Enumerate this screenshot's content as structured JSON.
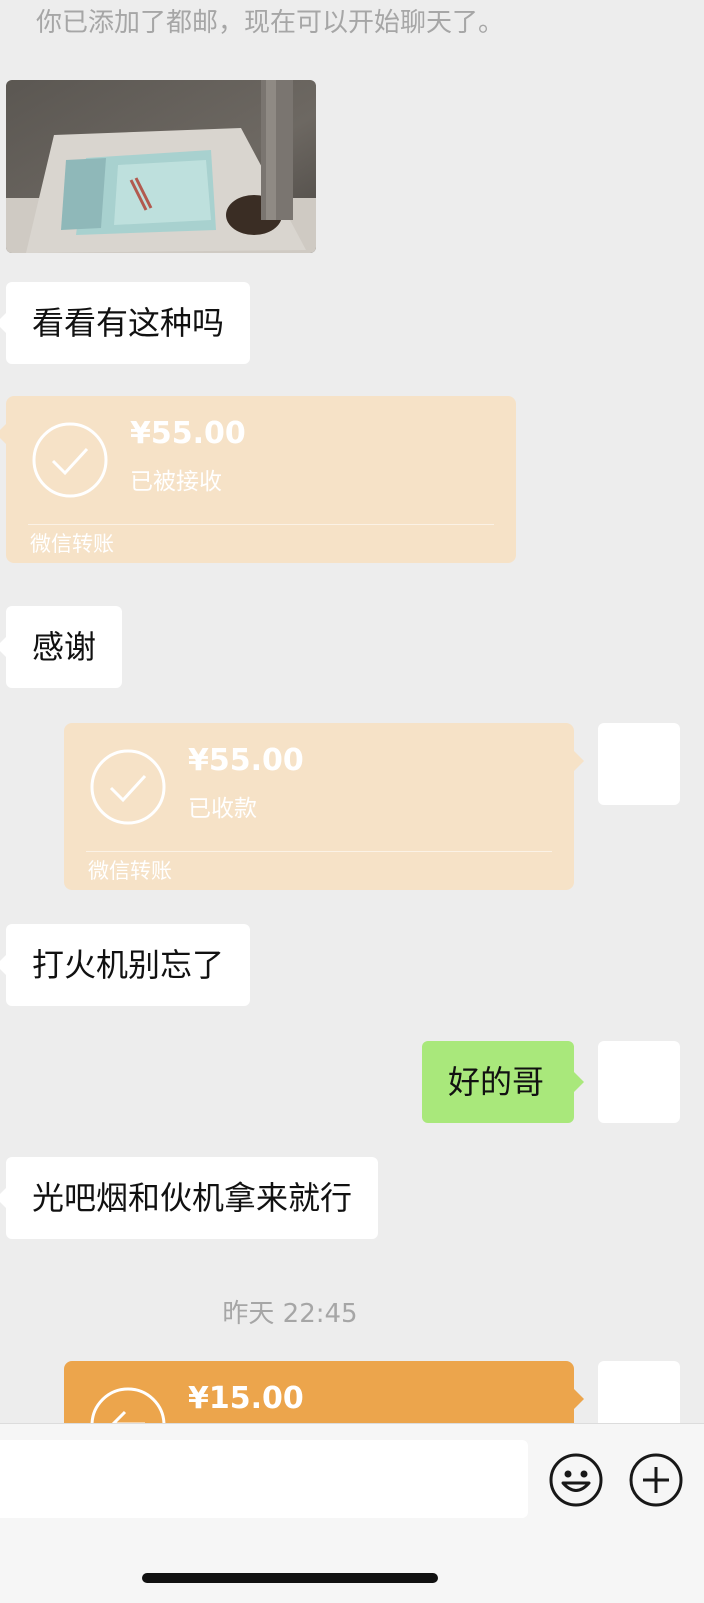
{
  "system_notice": "你已添加了都邮，现在可以开始聊天了。",
  "messages": {
    "m1_text": "看看有这种吗",
    "t1": {
      "amount": "¥55.00",
      "status": "已被接收",
      "brand": "微信转账"
    },
    "m2_text": "感谢",
    "t2": {
      "amount": "¥55.00",
      "status": "已收款",
      "brand": "微信转账"
    },
    "m3_text": "打火机别忘了",
    "m4_text": "好的哥",
    "m5_text": "光吧烟和伙机拿来就行",
    "timestamp": "昨天 22:45",
    "t3": {
      "amount": "¥15.00"
    }
  },
  "colors": {
    "background": "#ededed",
    "incoming_bubble": "#ffffff",
    "outgoing_bubble": "#a9e87b",
    "transfer_received": "#f6e2c7",
    "transfer_pending": "#eca54c"
  },
  "icons": [
    "check-circle-icon",
    "return-arrow-icon",
    "emoji-icon",
    "plus-icon"
  ]
}
